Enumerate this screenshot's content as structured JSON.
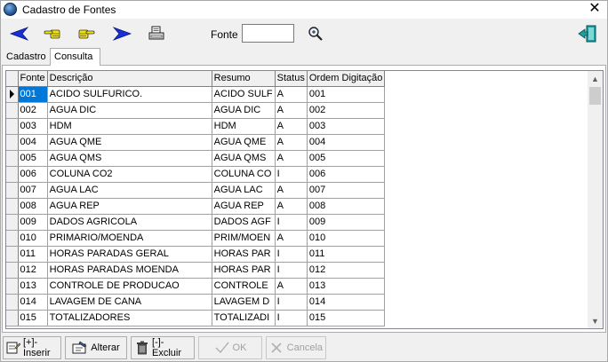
{
  "window": {
    "title": "Cadastro de Fontes",
    "close_glyph": "✕"
  },
  "toolbar": {
    "fonte_label": "Fonte",
    "fonte_value": ""
  },
  "tabs": [
    "Cadastro",
    "Consulta"
  ],
  "grid": {
    "columns": [
      "Fonte",
      "Descrição",
      "Resumo",
      "Status",
      "Ordem Digitação"
    ],
    "rows": [
      [
        "001",
        "ACIDO SULFURICO.",
        "ACIDO SULF",
        "A",
        "001"
      ],
      [
        "002",
        "AGUA DIC",
        "AGUA DIC",
        "A",
        "002"
      ],
      [
        "003",
        "HDM",
        "HDM",
        "A",
        "003"
      ],
      [
        "004",
        "AGUA QME",
        "AGUA QME",
        "A",
        "004"
      ],
      [
        "005",
        "AGUA QMS",
        "AGUA QMS",
        "A",
        "005"
      ],
      [
        "006",
        "COLUNA CO2",
        "COLUNA CO",
        "I",
        "006"
      ],
      [
        "007",
        "AGUA LAC",
        "AGUA LAC",
        "A",
        "007"
      ],
      [
        "008",
        "AGUA REP",
        "AGUA REP",
        "A",
        "008"
      ],
      [
        "009",
        "DADOS AGRICOLA",
        "DADOS AGF",
        "I",
        "009"
      ],
      [
        "010",
        "PRIMARIO/MOENDA",
        "PRIM/MOEN",
        "A",
        "010"
      ],
      [
        "011",
        "HORAS PARADAS GERAL",
        "HORAS PAR",
        "I",
        "011"
      ],
      [
        "012",
        "HORAS PARADAS MOENDA",
        "HORAS PAR",
        "I",
        "012"
      ],
      [
        "013",
        "CONTROLE DE PRODUCAO",
        "CONTROLE",
        "A",
        "013"
      ],
      [
        "014",
        "LAVAGEM DE CANA",
        "LAVAGEM D",
        "I",
        "014"
      ],
      [
        "015",
        "TOTALIZADORES",
        "TOTALIZADI",
        "I",
        "015"
      ]
    ],
    "selected_row": 0
  },
  "buttons": {
    "inserir": "[+]-Inserir",
    "alterar": "Alterar",
    "excluir": "[-]-Excluir",
    "ok": "OK",
    "cancela": "Cancela"
  },
  "colors": {
    "accent": "#0078d7",
    "arrow_blue": "#1a2fd0",
    "hand_yellow": "#f2e200",
    "exit_teal": "#1aa0a0"
  },
  "icons": {
    "first": "arrow-left-icon",
    "prev": "hand-left-icon",
    "next": "hand-right-icon",
    "last": "arrow-right-icon",
    "print": "printer-icon",
    "search": "magnifier-icon",
    "exit": "exit-door-icon",
    "inserir": "insert-icon",
    "alterar": "edit-icon",
    "excluir": "trash-icon",
    "ok": "checkmark-icon",
    "cancela": "cancel-icon"
  }
}
